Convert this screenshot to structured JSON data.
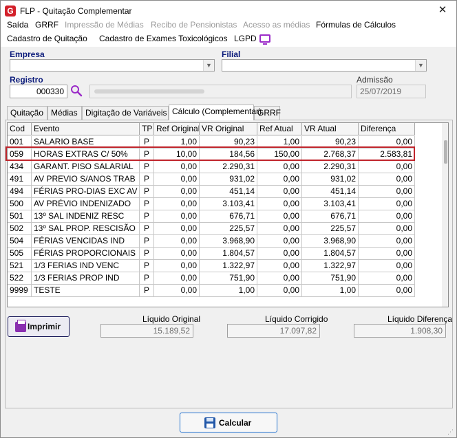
{
  "window": {
    "title": "FLP - Quitação Complementar",
    "app_icon": "G",
    "close_icon": "✕"
  },
  "menu": {
    "row1": [
      "Saída",
      "GRRF",
      "Impressão de Médias",
      "Recibo de Pensionistas",
      "Acesso as médias",
      "Fórmulas de Cálculos"
    ],
    "row2": [
      "Cadastro de Quitação",
      "Cadastro de Exames Toxicológicos",
      "LGPD"
    ]
  },
  "form": {
    "empresa_label": "Empresa",
    "filial_label": "Filial",
    "registro_label": "Registro",
    "registro_value": "000330",
    "admissao_label": "Admissão",
    "admissao_value": "25/07/2019"
  },
  "tabs": [
    "Quitação",
    "Médias",
    "Digitação de Variáveis",
    "Cálculo (Complementar)",
    "GRRF"
  ],
  "grid": {
    "columns": [
      "Cod",
      "Evento",
      "TP",
      "Ref Original",
      "VR Original",
      "Ref Atual",
      "VR Atual",
      "Diferença"
    ],
    "rows": [
      [
        "001",
        "SALARIO BASE",
        "P",
        "1,00",
        "90,23",
        "1,00",
        "90,23",
        "0,00"
      ],
      [
        "059",
        "HORAS EXTRAS C/ 50%",
        "P",
        "10,00",
        "184,56",
        "150,00",
        "2.768,37",
        "2.583,81"
      ],
      [
        "434",
        "GARANT. PISO SALARIAL",
        "P",
        "0,00",
        "2.290,31",
        "0,00",
        "2.290,31",
        "0,00"
      ],
      [
        "491",
        "AV PREVIO S/ANOS TRAB",
        "P",
        "0,00",
        "931,02",
        "0,00",
        "931,02",
        "0,00"
      ],
      [
        "494",
        "FÉRIAS PRO-DIAS EXC AV",
        "P",
        "0,00",
        "451,14",
        "0,00",
        "451,14",
        "0,00"
      ],
      [
        "500",
        "AV PRÉVIO INDENIZADO",
        "P",
        "0,00",
        "3.103,41",
        "0,00",
        "3.103,41",
        "0,00"
      ],
      [
        "501",
        "13º SAL INDENIZ RESC",
        "P",
        "0,00",
        "676,71",
        "0,00",
        "676,71",
        "0,00"
      ],
      [
        "502",
        "13º SAL PROP. RESCISÃO",
        "P",
        "0,00",
        "225,57",
        "0,00",
        "225,57",
        "0,00"
      ],
      [
        "504",
        "FÉRIAS VENCIDAS IND",
        "P",
        "0,00",
        "3.968,90",
        "0,00",
        "3.968,90",
        "0,00"
      ],
      [
        "505",
        "FÉRIAS PROPORCIONAIS",
        "P",
        "0,00",
        "1.804,57",
        "0,00",
        "1.804,57",
        "0,00"
      ],
      [
        "521",
        "1/3 FERIAS IND VENC",
        "P",
        "0,00",
        "1.322,97",
        "0,00",
        "1.322,97",
        "0,00"
      ],
      [
        "522",
        "1/3 FERIAS PROP IND",
        "P",
        "0,00",
        "751,90",
        "0,00",
        "751,90",
        "0,00"
      ],
      [
        "9999",
        "TESTE",
        "P",
        "0,00",
        "1,00",
        "0,00",
        "1,00",
        "0,00"
      ]
    ]
  },
  "totals": {
    "liquido_original_label": "Líquido Original",
    "liquido_original_value": "15.189,52",
    "liquido_corrigido_label": "Líquido Corrigido",
    "liquido_corrigido_value": "17.097,82",
    "liquido_diferenca_label": "Líquido Diferença",
    "liquido_diferenca_value": "1.908,30"
  },
  "buttons": {
    "print_label": "Imprimir",
    "calc_label": "Calcular"
  },
  "colors": {
    "accent_purple": "#9b2bc8",
    "highlight_red": "#c0242b",
    "label_blue": "#0a1a7a"
  }
}
